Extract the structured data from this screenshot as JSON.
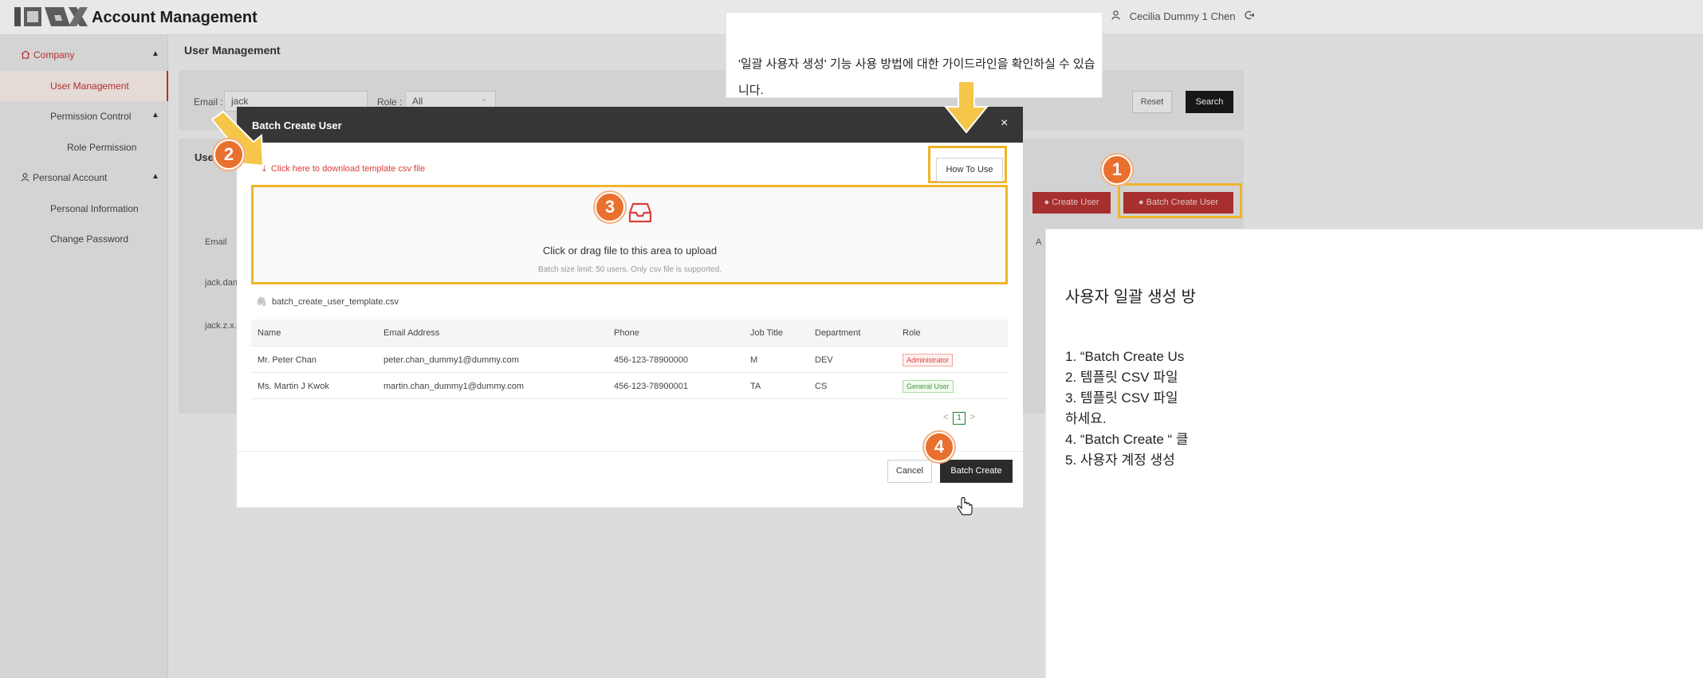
{
  "header": {
    "logo_text": "ICAX",
    "title": "Account Management",
    "user_name": "Cecilia Dummy 1 Chen"
  },
  "sidebar": {
    "items": [
      {
        "label": "Company"
      },
      {
        "label": "User Management"
      },
      {
        "label": "Permission Control"
      },
      {
        "label": "Role Permission"
      },
      {
        "label": "Personal Account"
      },
      {
        "label": "Personal Information"
      },
      {
        "label": "Change Password"
      }
    ]
  },
  "main": {
    "page_title": "User Management",
    "filter": {
      "email_label": "Email :",
      "email_value": "jack",
      "role_label": "Role :",
      "role_value": "All",
      "reset_label": "Reset",
      "search_label": "Search"
    },
    "list": {
      "title": "Use",
      "col_email": "Email",
      "col_a": "A",
      "rows": [
        "jack.dan",
        "jack.z.x."
      ]
    },
    "create_user_label": "Create User",
    "batch_create_user_label": "Batch Create User"
  },
  "callout_top": {
    "text": "'일괄 사용자 생성' 기능 사용 방법에 대한 가이드라인을 확인하실 수 있습니다."
  },
  "modal": {
    "title": "Batch Create User",
    "close": "×",
    "download_link": "Click here to download template csv file",
    "how_to_use": "How To Use",
    "dropzone_main": "Click or drag file to this area to upload",
    "dropzone_hint": "Batch size limit: 50 users. Only csv file is supported.",
    "file_name": "batch_create_user_template.csv",
    "table": {
      "headers": [
        "Name",
        "Email Address",
        "Phone",
        "Job Title",
        "Department",
        "Role"
      ],
      "rows": [
        [
          "Mr. Peter Chan",
          "peter.chan_dummy1@dummy.com",
          "456-123-78900000",
          "M",
          "DEV",
          "Administrator"
        ],
        [
          "Ms. Martin J Kwok",
          "martin.chan_dummy1@dummy.com",
          "456-123-78900001",
          "TA",
          "CS",
          "General User"
        ]
      ]
    },
    "pagination": {
      "prev": "<",
      "page": "1",
      "next": ">"
    },
    "cancel_label": "Cancel",
    "batch_create_label": "Batch Create"
  },
  "badges": [
    "1",
    "2",
    "3",
    "4"
  ],
  "callout_right": {
    "title": "사용자 일괄 생성 방",
    "lines": [
      "1. “Batch Create Us",
      "2. 템플릿 CSV 파일",
      "3. 템플릿 CSV 파일",
      "하세요.",
      "4. “Batch Create “ 클",
      "5. 사용자 계정 생성"
    ]
  },
  "colors": {
    "brand_red": "#c23532",
    "highlight_yellow": "#f0b429",
    "badge_orange": "#e9702f",
    "modal_header": "#363636"
  },
  "icons": [
    "home-icon",
    "user-icon",
    "logout-icon",
    "download-icon",
    "inbox-icon",
    "paperclip-icon",
    "plus-circle-icon",
    "chevron-up-icon"
  ]
}
